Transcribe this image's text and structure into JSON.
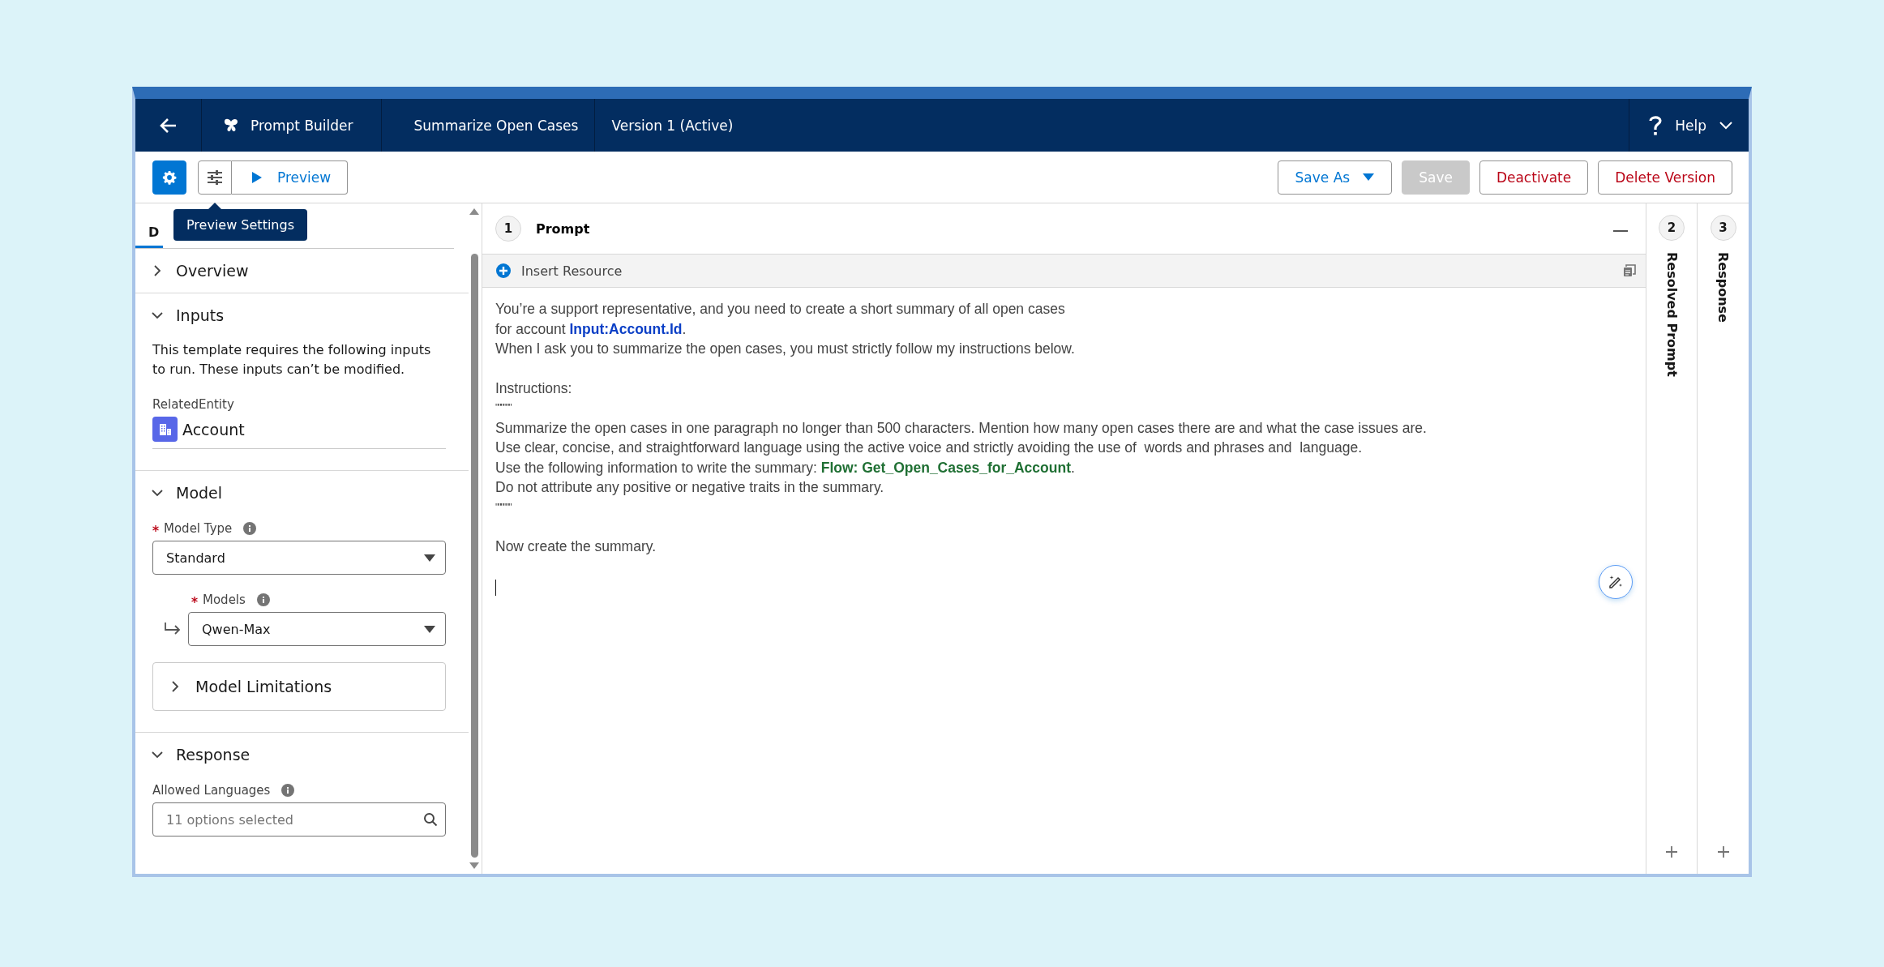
{
  "header": {
    "app_name": "Prompt Builder",
    "template_name": "Summarize Open Cases",
    "version": "Version 1 (Active)",
    "help": "Help"
  },
  "toolbar": {
    "settings_selected": true,
    "preview_button": "Preview",
    "tooltip": "Preview Settings",
    "actions": [
      {
        "label": "Save As",
        "kind": "dropdown",
        "disabled": false
      },
      {
        "label": "Save",
        "kind": "plain",
        "disabled": true
      },
      {
        "label": "Deactivate",
        "kind": "destructive",
        "disabled": false
      },
      {
        "label": "Delete Version",
        "kind": "destructive",
        "disabled": false
      }
    ]
  },
  "left_panel": {
    "tabs": [
      {
        "label": "D",
        "selected": true
      }
    ],
    "sections": [
      {
        "title": "Overview",
        "expanded": false
      },
      {
        "title": "Inputs",
        "expanded": true,
        "description": "This template requires the following inputs to run. These inputs can’t be modified.",
        "input_label": "RelatedEntity",
        "input_value": "Account"
      },
      {
        "title": "Model",
        "expanded": true,
        "model_type_label": "Model Type",
        "model_type": "Standard",
        "models_label": "Models",
        "model": "Qwen-Max",
        "limitations": {
          "title": "Model Limitations",
          "expanded": false
        }
      },
      {
        "title": "Response",
        "expanded": true,
        "languages_label": "Allowed Languages",
        "languages_placeholder": "11 options selected"
      }
    ]
  },
  "prompt": {
    "step": "1",
    "title": "Prompt",
    "insert_resource": "Insert Resource",
    "blocks": [
      [
        [
          {
            "kind": "text",
            "text": "You’re a support representative, and you need to create a short summary of all open cases"
          }
        ],
        [
          {
            "kind": "text",
            "text": "for account "
          },
          {
            "kind": "input",
            "text": "Input:Account.Id"
          },
          {
            "kind": "text",
            "text": "."
          }
        ],
        [
          {
            "kind": "text",
            "text": "When I ask you to summarize the open cases, you must strictly follow my instructions below."
          }
        ]
      ],
      [
        [
          {
            "kind": "text",
            "text": "Instructions:"
          }
        ],
        [
          {
            "kind": "quote",
            "text": "\"\"\"\"\"\""
          }
        ],
        [
          {
            "kind": "text",
            "text": "Summarize the open cases in one paragraph no longer than 500 characters. Mention how many open cases there are and what the case issues are."
          }
        ],
        [
          {
            "kind": "text",
            "text": "Use clear, concise, and straightforward language using the active voice and strictly avoiding the use of  words and phrases and  language."
          }
        ],
        [
          {
            "kind": "text",
            "text": "Use the following information to write the summary: "
          },
          {
            "kind": "flow",
            "text": "Flow: Get_Open_Cases_for_Account"
          },
          {
            "kind": "text",
            "text": "."
          }
        ],
        [
          {
            "kind": "text",
            "text": "Do not attribute any positive or negative traits in the summary."
          }
        ],
        [
          {
            "kind": "quote",
            "text": "\"\"\"\"\"\""
          }
        ]
      ],
      [
        [
          {
            "kind": "text",
            "text": "Now create the summary."
          }
        ]
      ]
    ]
  },
  "side_columns": [
    {
      "step": "2",
      "title": "Resolved Prompt"
    },
    {
      "step": "3",
      "title": "Response"
    }
  ]
}
